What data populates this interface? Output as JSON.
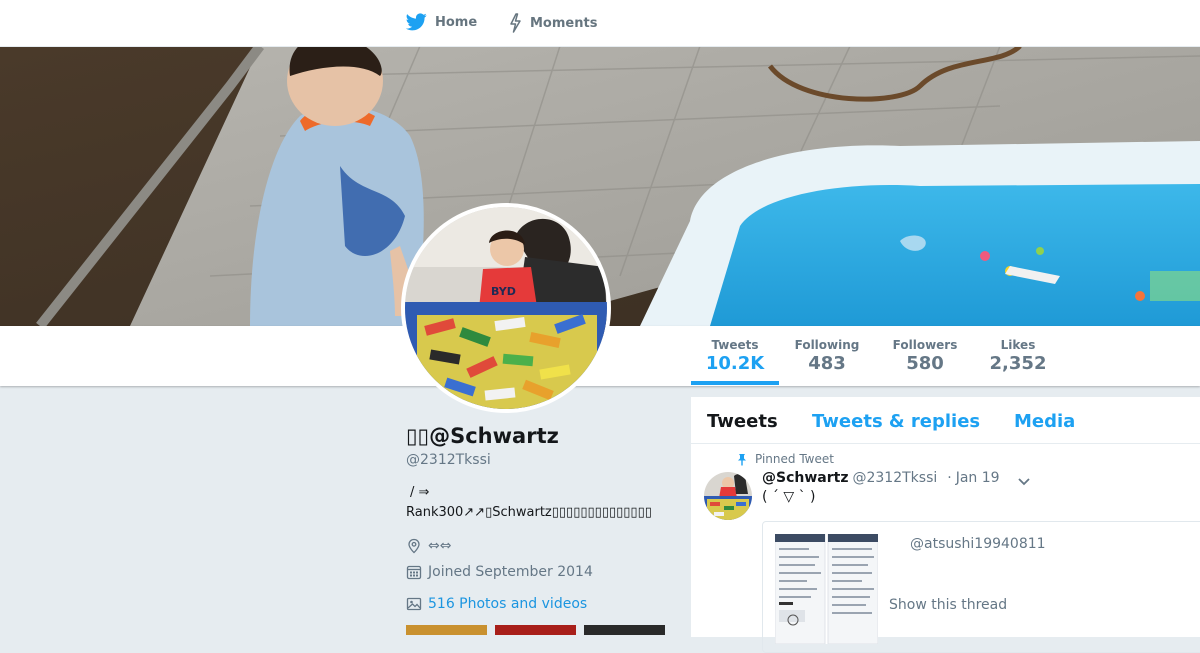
{
  "nav": {
    "items": [
      {
        "label": "Home",
        "icon": "twitter-bird-icon"
      },
      {
        "label": "Moments",
        "icon": "lightning-icon"
      }
    ]
  },
  "colors": {
    "accent": "#1da1f2",
    "link": "#1b95e0",
    "muted": "#657786",
    "background": "#e6ecf0"
  },
  "stats": [
    {
      "label": "Tweets",
      "value": "10.2K"
    },
    {
      "label": "Following",
      "value": "483"
    },
    {
      "label": "Followers",
      "value": "580"
    },
    {
      "label": "Likes",
      "value": "2,352"
    }
  ],
  "profile": {
    "display_name": "▯▯@Schwartz",
    "handle": "@2312Tkssi",
    "bio_line1": "/ ⇒",
    "bio_line2": "Rank300↗↗▯Schwartz▯▯▯▯▯▯▯▯▯▯▯▯▯▯",
    "location": "⇔⇔",
    "joined": "Joined September 2014",
    "photos_link": "516 Photos and videos"
  },
  "tabs": [
    {
      "label": "Tweets",
      "active": true
    },
    {
      "label": "Tweets & replies",
      "active": false
    },
    {
      "label": "Media",
      "active": false
    }
  ],
  "tweet": {
    "pinned_label": "Pinned Tweet",
    "name": "@Schwartz",
    "handle": "@2312Tkssi",
    "date": "Jan 19",
    "separator": "·",
    "text": "( ´ ▽ ` )",
    "quote": {
      "user": "@atsushi19940811",
      "show_thread": "Show this thread"
    }
  }
}
